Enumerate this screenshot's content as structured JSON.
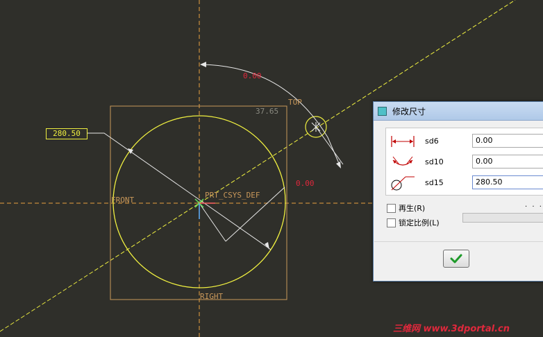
{
  "canvas": {
    "dimensions": {
      "angle_top": "0.00",
      "angle_right": "0.00",
      "diameter_box": "280.50",
      "ref_grey": "37.65"
    },
    "datum_labels": {
      "top": "TOP",
      "front": "FRONT",
      "right": "RIGHT",
      "csys": "PRT_CSYS_DEF"
    },
    "colors": {
      "background": "#2f2f2a",
      "sketch": "#f0f040",
      "datum": "#c9985a",
      "dimension": "#e0283c"
    }
  },
  "dialog": {
    "title": "修改尺寸",
    "rows": [
      {
        "name": "sd6",
        "value": "0.00",
        "icon": "linear-dimension-icon"
      },
      {
        "name": "sd10",
        "value": "0.00",
        "icon": "angular-dimension-icon"
      },
      {
        "name": "sd15",
        "value": "280.50",
        "icon": "diameter-dimension-icon"
      }
    ],
    "regenerate_label": "再生(R)",
    "lock_scale_label": "锁定比例(L)",
    "dots": "· · ·",
    "ok_icon": "checkmark-icon"
  },
  "watermark": "三维网 www.3dportal.cn"
}
